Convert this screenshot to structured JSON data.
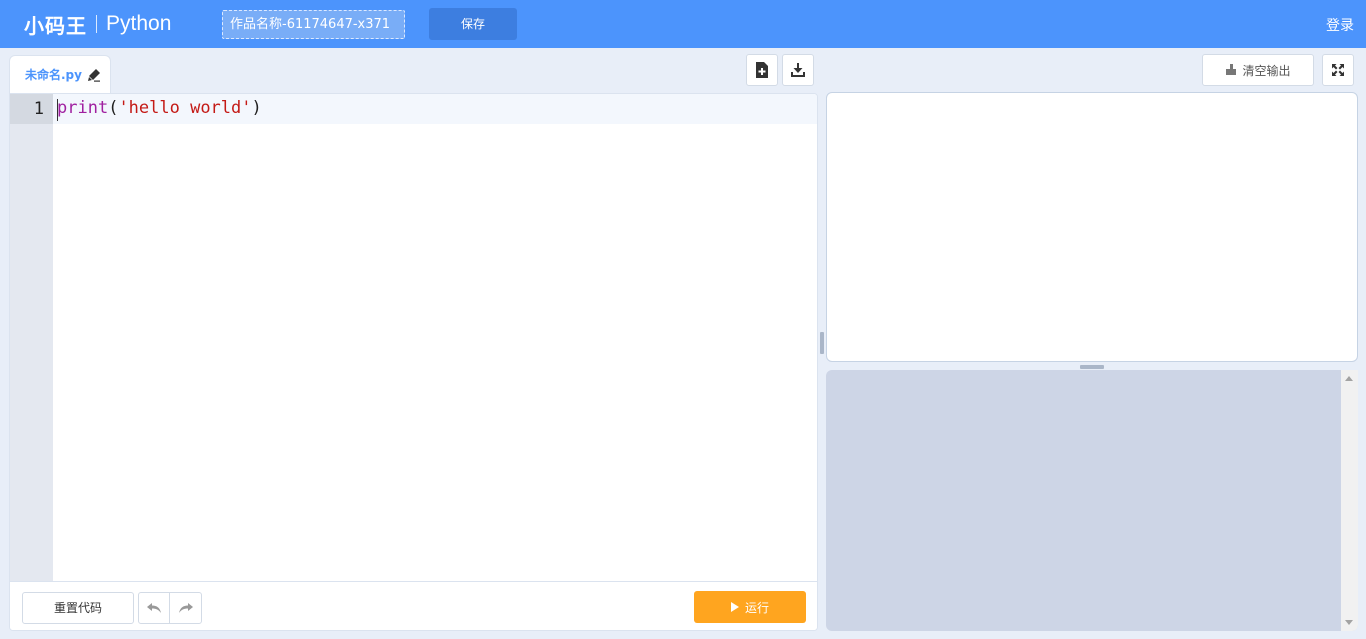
{
  "header": {
    "logo_text": "小码王",
    "logo_sub": "Python",
    "project_name": "作品名称-61174647-x371",
    "save_label": "保存",
    "login_label": "登录",
    "bg_color": "#4c94fc"
  },
  "editor": {
    "tab_label": "未命名.py",
    "tab_icon": "pencil-icon",
    "toolbar_icons": [
      "new-file-icon",
      "download-icon"
    ],
    "line_numbers": [
      "1"
    ],
    "code": {
      "func": "print",
      "open": "(",
      "string": "'hello world'",
      "close": ")"
    },
    "footer": {
      "reset_label": "重置代码",
      "undo_icon": "undo-icon",
      "redo_icon": "redo-icon",
      "run_label": "运行",
      "run_color": "#ffa51f"
    }
  },
  "output": {
    "clear_label": "清空输出",
    "clear_icon": "broom-icon",
    "fullscreen_icon": "fullscreen-icon"
  }
}
